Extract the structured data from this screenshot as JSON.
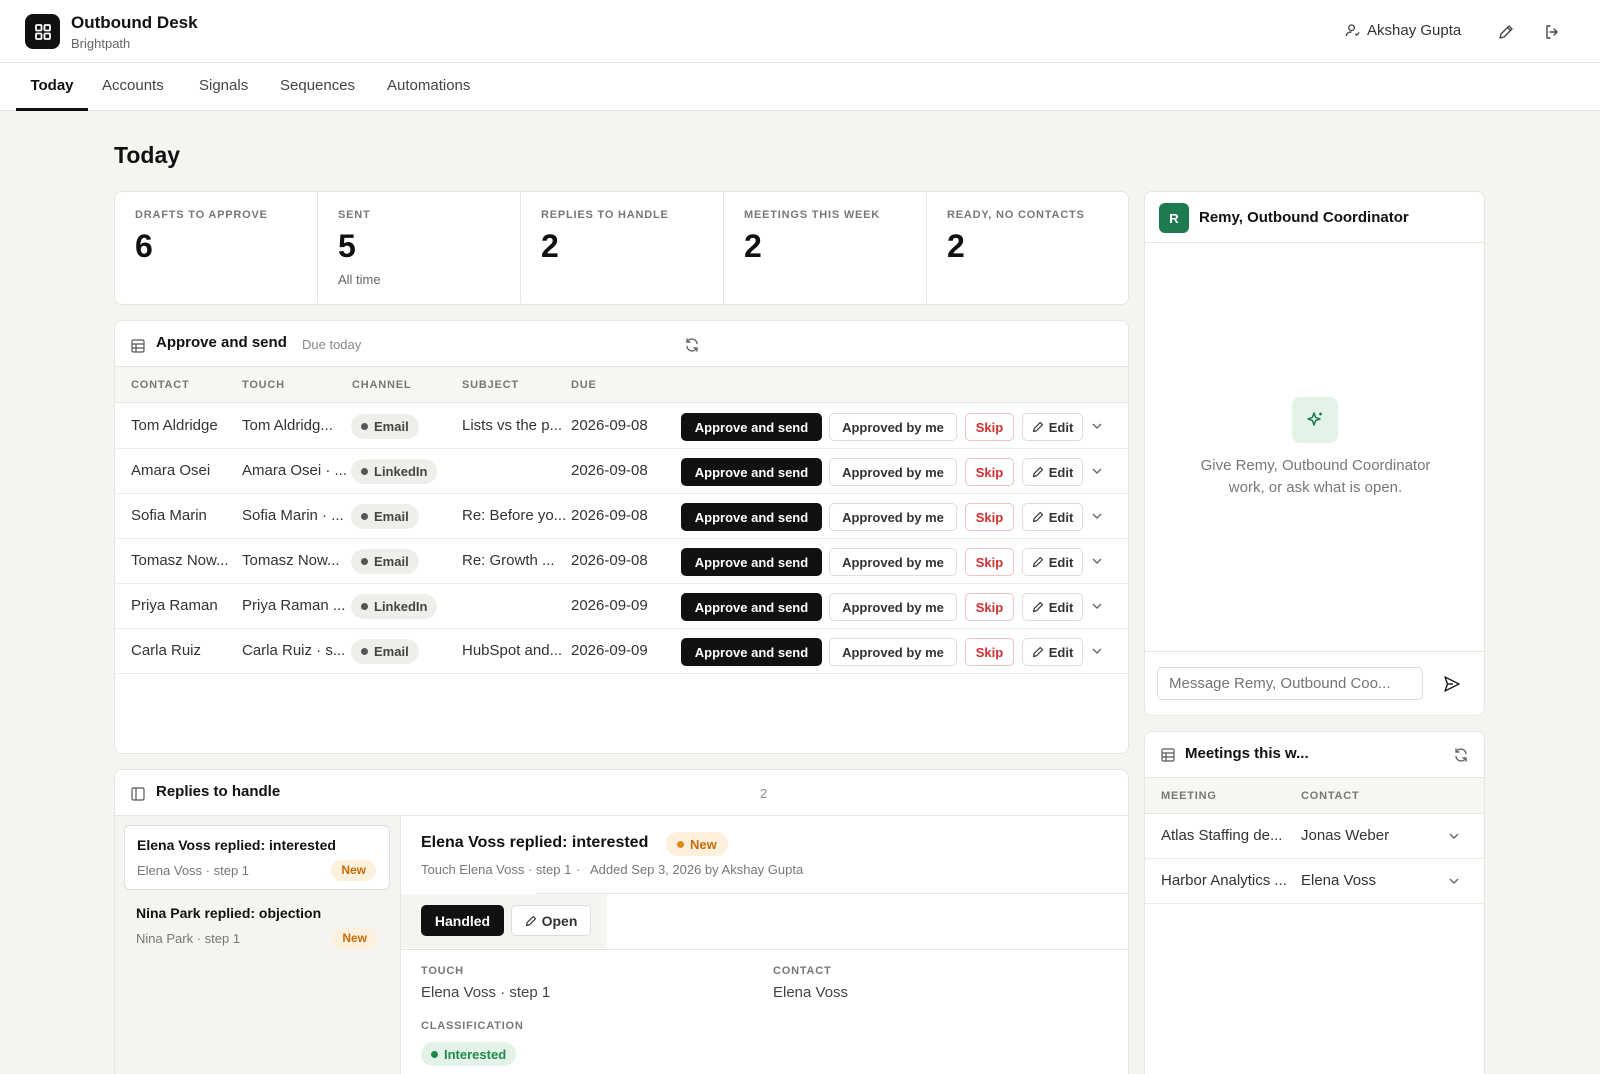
{
  "app": {
    "title": "Outbound Desk",
    "subtitle": "Brightpath"
  },
  "user": {
    "name": "Akshay Gupta"
  },
  "header_icons": [
    "user-icon",
    "pencil-icon",
    "logout-icon"
  ],
  "nav": {
    "tabs": [
      "Today",
      "Accounts",
      "Signals",
      "Sequences",
      "Automations"
    ],
    "active": "Today"
  },
  "page_title": "Today",
  "stats": [
    {
      "label": "DRAFTS TO APPROVE",
      "value": "6",
      "sub": ""
    },
    {
      "label": "SENT",
      "value": "5",
      "sub": "All time"
    },
    {
      "label": "REPLIES TO HANDLE",
      "value": "2",
      "sub": ""
    },
    {
      "label": "MEETINGS THIS WEEK",
      "value": "2",
      "sub": ""
    },
    {
      "label": "READY, NO CONTACTS",
      "value": "2",
      "sub": ""
    }
  ],
  "approve": {
    "title": "Approve and send",
    "subtitle": "Due today",
    "columns": [
      "CONTACT",
      "TOUCH",
      "CHANNEL",
      "SUBJECT",
      "DUE"
    ],
    "buttons": {
      "approve": "Approve and send",
      "approved": "Approved by me",
      "skip": "Skip",
      "edit": "Edit"
    },
    "rows": [
      {
        "contact": "Tom Aldridge",
        "touch": "Tom Aldridg...",
        "channel": "Email",
        "subject": "Lists vs the p...",
        "due": "2026-09-08"
      },
      {
        "contact": "Amara Osei",
        "touch": "Amara Osei · ...",
        "channel": "LinkedIn",
        "subject": "",
        "due": "2026-09-08"
      },
      {
        "contact": "Sofia Marin",
        "touch": "Sofia Marin · ...",
        "channel": "Email",
        "subject": "Re: Before yo...",
        "due": "2026-09-08"
      },
      {
        "contact": "Tomasz Now...",
        "touch": "Tomasz Now...",
        "channel": "Email",
        "subject": "Re: Growth ...",
        "due": "2026-09-08"
      },
      {
        "contact": "Priya Raman",
        "touch": "Priya Raman ...",
        "channel": "LinkedIn",
        "subject": "",
        "due": "2026-09-09"
      },
      {
        "contact": "Carla Ruiz",
        "touch": "Carla Ruiz · s...",
        "channel": "Email",
        "subject": "HubSpot and...",
        "due": "2026-09-09"
      }
    ]
  },
  "replies": {
    "title": "Replies to handle",
    "count": "2",
    "items": [
      {
        "title": "Elena Voss replied: interested",
        "meta": "Elena Voss · step 1",
        "badge": "New"
      },
      {
        "title": "Nina Park replied: objection",
        "meta": "Nina Park · step 1",
        "badge": "New"
      }
    ],
    "detail": {
      "title": "Elena Voss replied: interested",
      "badge": "New",
      "meta_touch": "Touch Elena Voss · step 1",
      "meta_added": "Added Sep 3, 2026 by Akshay Gupta",
      "handled_label": "Handled",
      "open_label": "Open",
      "touch_label": "TOUCH",
      "touch_value": "Elena Voss · step 1",
      "contact_label": "CONTACT",
      "contact_value": "Elena Voss",
      "classification_label": "CLASSIFICATION",
      "classification_value": "Interested"
    }
  },
  "assistant": {
    "avatar": "R",
    "name": "Remy, Outbound Coordinator",
    "empty_text_line1": "Give Remy, Outbound Coordinator",
    "empty_text_line2": "work, or ask what is open.",
    "input_placeholder": "Message Remy, Outbound Coo..."
  },
  "meetings": {
    "title": "Meetings this w...",
    "columns": [
      "MEETING",
      "CONTACT"
    ],
    "rows": [
      {
        "meeting": "Atlas Staffing de...",
        "contact": "Jonas Weber"
      },
      {
        "meeting": "Harbor Analytics ...",
        "contact": "Elena Voss"
      }
    ]
  },
  "colors": {
    "accent_dark": "#111111",
    "skip_red": "#d03131",
    "new_orange": "#c76a0a",
    "interested_green": "#1f8a4c",
    "assistant_green": "#1e7a4f"
  }
}
